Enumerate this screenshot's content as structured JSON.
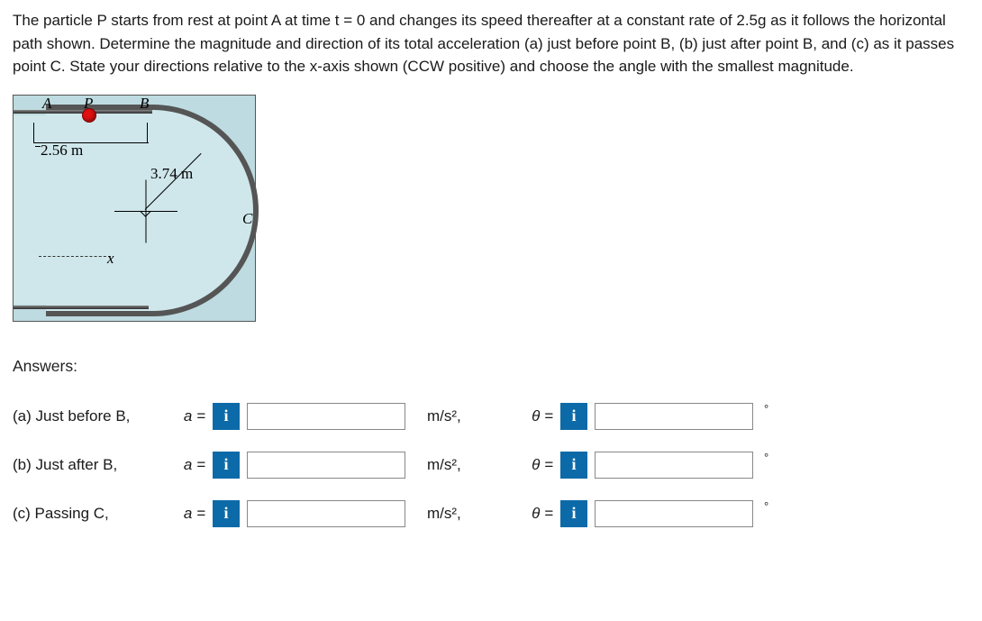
{
  "problem_text": "The particle P starts from rest at point A at time t = 0 and changes its speed thereafter at a constant rate of 2.5g as it follows the horizontal path shown. Determine the magnitude and direction of its total acceleration (a) just before point B, (b) just after point B, and (c) as it passes point C. State your directions relative to the x-axis shown (CCW positive) and choose the angle with the smallest magnitude.",
  "diagram": {
    "label_A": "A",
    "label_P": "P",
    "label_B": "B",
    "label_C": "C",
    "dim_AB": "2.56 m",
    "radius": "3.74 m",
    "x_axis": "x"
  },
  "answers_heading": "Answers:",
  "rows": [
    {
      "label": "(a) Just before B,",
      "a_sym": "a =",
      "unit": "m/s²,",
      "theta_sym": "θ ="
    },
    {
      "label": "(b) Just after B,",
      "a_sym": "a =",
      "unit": "m/s²,",
      "theta_sym": "θ ="
    },
    {
      "label": "(c) Passing C,",
      "a_sym": "a =",
      "unit": "m/s²,",
      "theta_sym": "θ ="
    }
  ],
  "info_icon": "i",
  "degree_symbol": "°"
}
